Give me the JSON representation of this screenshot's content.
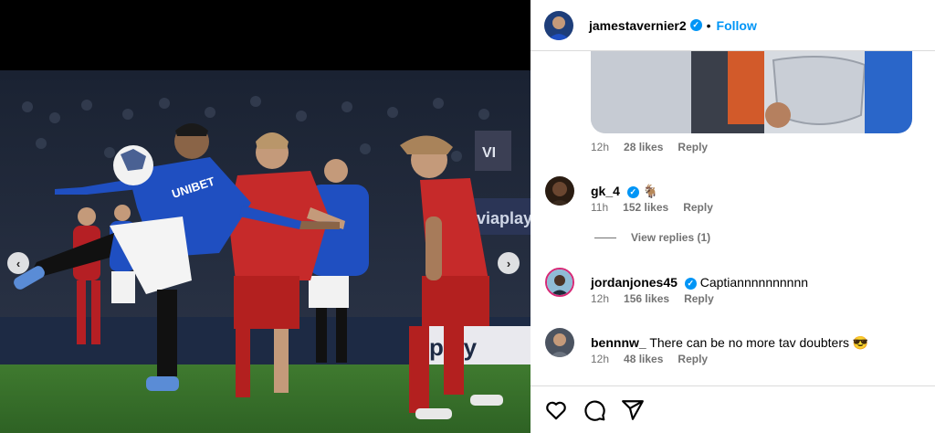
{
  "post": {
    "username": "jamestavernier2",
    "separator": "•",
    "follow_label": "Follow",
    "verified_icon": "verified-badge-icon"
  },
  "photo": {
    "sponsor_text": "UNIBET",
    "board_text_1": "play",
    "board_text_2": "viaplay",
    "ad_text": "VI",
    "nav_prev": "‹",
    "nav_next": "›"
  },
  "comments": [
    {
      "meta_time": "12h",
      "meta_likes": "28 likes",
      "meta_reply": "Reply"
    },
    {
      "username": "gk_4",
      "text": "🐐",
      "meta_time": "11h",
      "meta_likes": "152 likes",
      "meta_reply": "Reply",
      "replies_label": "View replies (1)"
    },
    {
      "username": "jordanjones45",
      "text": "Captiannnnnnnnnn",
      "meta_time": "12h",
      "meta_likes": "156 likes",
      "meta_reply": "Reply"
    },
    {
      "username": "bennnw_",
      "text": "There can be no more tav doubters 😎",
      "meta_time": "12h",
      "meta_likes": "48 likes",
      "meta_reply": "Reply"
    }
  ],
  "colors": {
    "accent": "#0095f6",
    "muted": "#737373",
    "border": "#dbdbdb"
  }
}
